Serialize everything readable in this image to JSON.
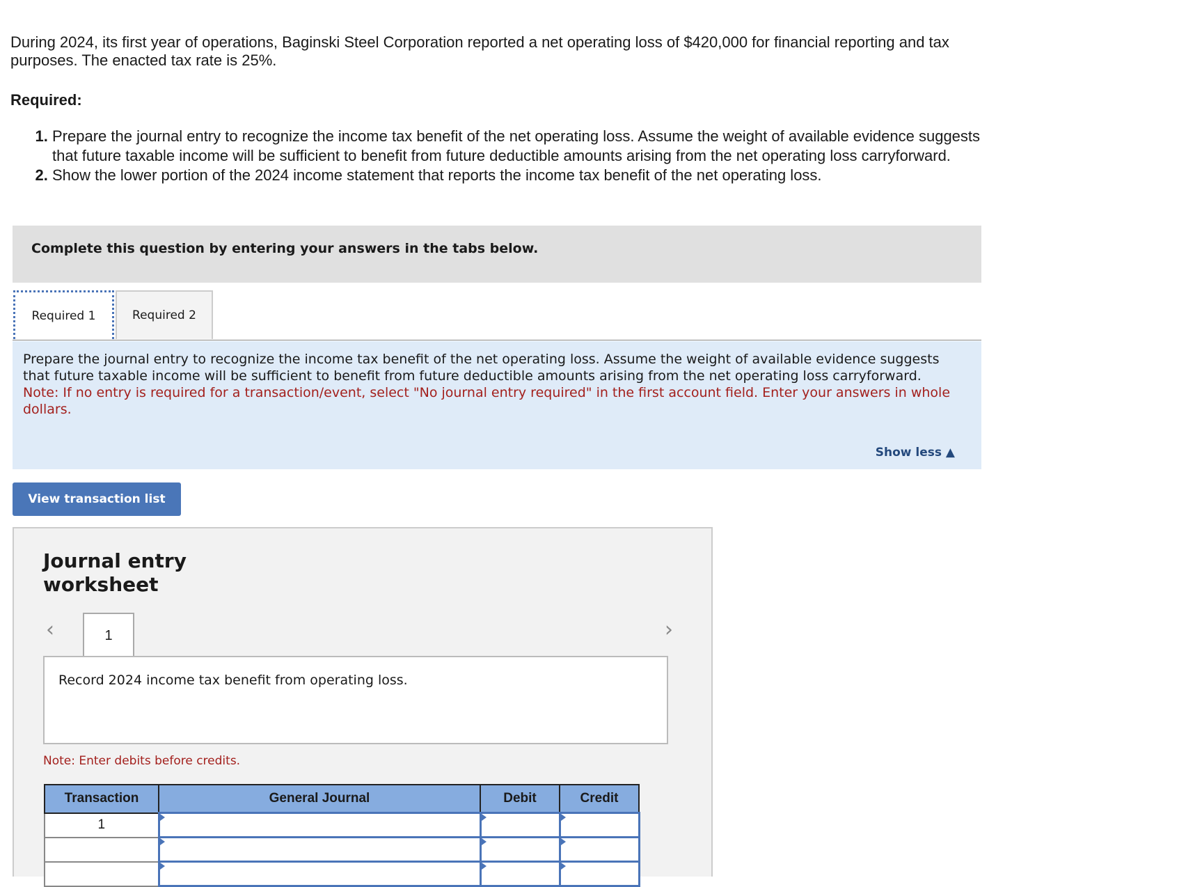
{
  "problem": {
    "intro": "During 2024, its first year of operations, Baginski Steel Corporation reported a net operating loss of $420,000 for financial reporting and tax purposes. The enacted tax rate is 25%.",
    "required_heading": "Required:",
    "requirements": [
      "Prepare the journal entry to recognize the income tax benefit of the net operating loss. Assume the weight of available evidence suggests that future taxable income will be sufficient to benefit from future deductible amounts arising from the net operating loss carryforward.",
      "Show the lower portion of the 2024 income statement that reports the income tax benefit of the net operating loss."
    ]
  },
  "banner": "Complete this question by entering your answers in the tabs below.",
  "tabs": [
    {
      "label": "Required 1",
      "active": true
    },
    {
      "label": "Required 2",
      "active": false
    }
  ],
  "instructions": {
    "text": "Prepare the journal entry to recognize the income tax benefit of the net operating loss. Assume the weight of available evidence suggests that future taxable income will be sufficient to benefit from future deductible amounts arising from the net operating loss carryforward.",
    "note": "Note: If no entry is required for a transaction/event, select \"No journal entry required\" in the first account field. Enter your answers in whole dollars.",
    "show_less": "Show less ▲"
  },
  "view_transaction_button": "View transaction list",
  "worksheet": {
    "title_line1": "Journal entry",
    "title_line2": "worksheet",
    "prev_icon": "‹",
    "next_icon": "›",
    "page": "1",
    "description": "Record 2024 income tax benefit from operating loss.",
    "note": "Note: Enter debits before credits.",
    "table": {
      "headers": [
        "Transaction",
        "General Journal",
        "Debit",
        "Credit"
      ],
      "rows": [
        {
          "transaction": "1",
          "account": "",
          "debit": "",
          "credit": ""
        },
        {
          "transaction": "",
          "account": "",
          "debit": "",
          "credit": ""
        },
        {
          "transaction": "",
          "account": "",
          "debit": "",
          "credit": ""
        }
      ]
    }
  }
}
